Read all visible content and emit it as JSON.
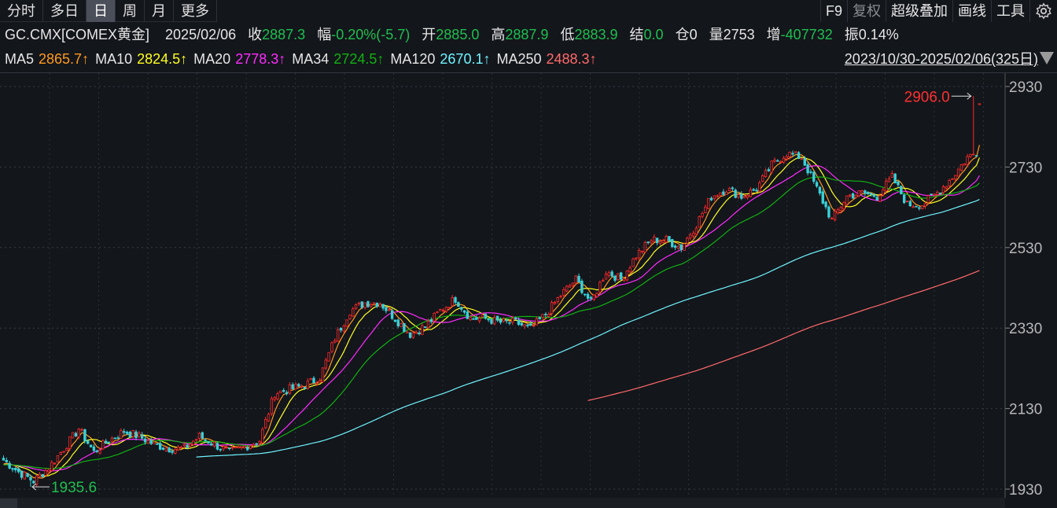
{
  "tabs": [
    {
      "label": "分时"
    },
    {
      "label": "多日"
    },
    {
      "label": "日",
      "selected": true
    },
    {
      "label": "周"
    },
    {
      "label": "月"
    },
    {
      "label": "更多"
    }
  ],
  "tools": [
    {
      "label": "F9"
    },
    {
      "label": "复权"
    },
    {
      "label": "超级叠加"
    },
    {
      "label": "画线"
    },
    {
      "label": "工具"
    }
  ],
  "info": {
    "symbol": "GC.CMX[COMEX黄金]",
    "date": "2025/02/06",
    "close_label": "收",
    "close": "2887.3",
    "change_label": "幅",
    "change": "-0.20%(-5.7)",
    "open_label": "开",
    "open": "2885.0",
    "high_label": "高",
    "high": "2887.9",
    "low_label": "低",
    "low": "2883.9",
    "settle_label": "结",
    "settle": "0.0",
    "oi_label": "仓",
    "oi": "0",
    "vol_label": "量",
    "vol": "2753",
    "inc_label": "增",
    "inc": "-407732",
    "amp_label": "振",
    "amp": "0.14%"
  },
  "ma": [
    {
      "name": "MA5",
      "value": "2865.7↑",
      "color": "#ff9a1f",
      "period": 5
    },
    {
      "name": "MA10",
      "value": "2824.5↑",
      "color": "#ffff20",
      "period": 10
    },
    {
      "name": "MA20",
      "value": "2778.3↑",
      "color": "#ff2cff",
      "period": 20
    },
    {
      "name": "MA34",
      "value": "2724.5↑",
      "color": "#12b012",
      "period": 34
    },
    {
      "name": "MA120",
      "value": "2670.1↑",
      "color": "#6ff3ff",
      "period": 120
    },
    {
      "name": "MA250",
      "value": "2488.3↑",
      "color": "#ff6a6a",
      "period": 250
    }
  ],
  "range_label": "2023/10/30-2025/02/06(325日)",
  "chart_data": {
    "type": "candlestick",
    "days": 325,
    "ylim": [
      1930,
      2930
    ],
    "yticks": [
      "2930",
      "2730",
      "2530",
      "2330",
      "2130",
      "1930"
    ],
    "ytick_values": [
      2930,
      2730,
      2530,
      2330,
      2130,
      1930
    ],
    "closes_every_5_days": [
      2002,
      1973,
      1950,
      1983,
      2031,
      2080,
      2022,
      2051,
      2074,
      2061,
      2041,
      2031,
      2031,
      2061,
      2041,
      2022,
      2035,
      2051,
      2168,
      2178,
      2188,
      2207,
      2305,
      2373,
      2393,
      2393,
      2354,
      2315,
      2334,
      2373,
      2403,
      2354,
      2354,
      2344,
      2344,
      2328,
      2364,
      2412,
      2451,
      2393,
      2471,
      2451,
      2510,
      2549,
      2549,
      2530,
      2588,
      2657,
      2676,
      2657,
      2676,
      2735,
      2764,
      2754,
      2676,
      2598,
      2657,
      2666,
      2657,
      2705,
      2637,
      2637,
      2666,
      2705,
      2754,
      2774,
      2832,
      2862,
      2887.3
    ],
    "last_candle": {
      "open": 2885.0,
      "high": 2887.9,
      "low": 2883.9,
      "close": 2887.3
    },
    "max_marker": {
      "value": "2906.0",
      "price": 2906.0,
      "day": 322
    },
    "min_marker": {
      "value": "1935.6",
      "price": 1935.6,
      "day": 9
    },
    "up_color": "#ff2a2a",
    "down_color": "#3ad0d8"
  }
}
